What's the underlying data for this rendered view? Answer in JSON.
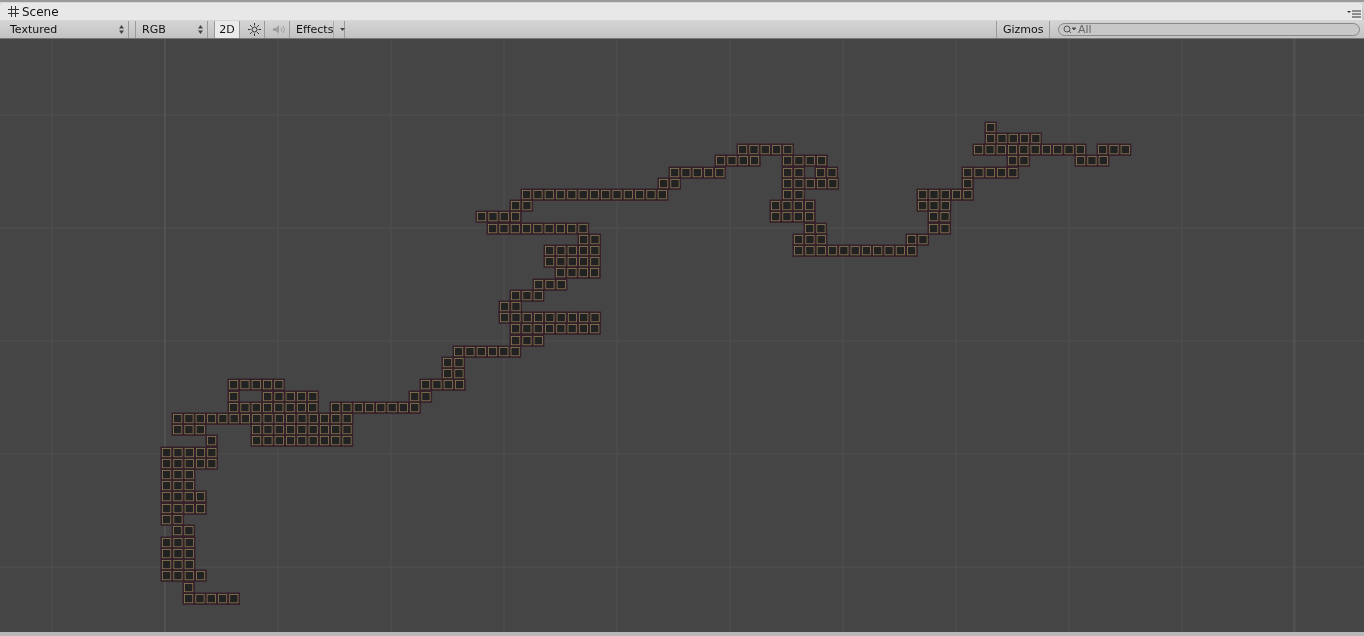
{
  "window": {
    "title": "Scene"
  },
  "toolbar": {
    "draw_mode": {
      "label": "Textured"
    },
    "render_mode": {
      "label": "RGB"
    },
    "mode_2d": {
      "label": "2D",
      "on": true
    },
    "lighting": {
      "on": false
    },
    "audio": {
      "disabled": true
    },
    "effects": {
      "label": "Effects"
    },
    "gizmos": {
      "label": "Gizmos"
    },
    "search": {
      "placeholder": "All"
    }
  }
}
